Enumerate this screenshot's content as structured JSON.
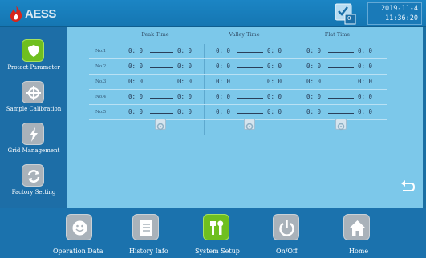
{
  "header": {
    "brand": "AESS",
    "status_count": "0",
    "date": "2019-11-4",
    "time": "11:36:20"
  },
  "sidebar": {
    "items": [
      {
        "label": "Protect Parameter",
        "icon": "shield-icon",
        "active": true
      },
      {
        "label": "Sample Calibration",
        "icon": "crosshair-icon",
        "active": false
      },
      {
        "label": "Grid Management",
        "icon": "lightning-icon",
        "active": false
      },
      {
        "label": "Factory Setting",
        "icon": "refresh-icon",
        "active": false
      }
    ]
  },
  "schedule": {
    "columns": [
      "Peak Time",
      "Valley Time",
      "Flat Time"
    ],
    "rows": [
      {
        "label": "No.1",
        "values": [
          [
            "0: 0",
            "0: 0"
          ],
          [
            "0: 0",
            "0: 0"
          ],
          [
            "0: 0",
            "0: 0"
          ]
        ]
      },
      {
        "label": "No.2",
        "values": [
          [
            "0: 0",
            "0: 0"
          ],
          [
            "0: 0",
            "0: 0"
          ],
          [
            "0: 0",
            "0: 0"
          ]
        ]
      },
      {
        "label": "No.3",
        "values": [
          [
            "0: 0",
            "0: 0"
          ],
          [
            "0: 0",
            "0: 0"
          ],
          [
            "0: 0",
            "0: 0"
          ]
        ]
      },
      {
        "label": "No.4",
        "values": [
          [
            "0: 0",
            "0: 0"
          ],
          [
            "0: 0",
            "0: 0"
          ],
          [
            "0: 0",
            "0: 0"
          ]
        ]
      },
      {
        "label": "No.5",
        "values": [
          [
            "0: 0",
            "0: 0"
          ],
          [
            "0: 0",
            "0: 0"
          ],
          [
            "0: 0",
            "0: 0"
          ]
        ]
      }
    ]
  },
  "nav": {
    "items": [
      {
        "label": "Operation Data",
        "icon": "smiley-icon",
        "active": false
      },
      {
        "label": "History Info",
        "icon": "document-icon",
        "active": false
      },
      {
        "label": "System Setup",
        "icon": "tools-icon",
        "active": true
      },
      {
        "label": "On/Off",
        "icon": "power-icon",
        "active": false
      },
      {
        "label": "Home",
        "icon": "home-icon",
        "active": false
      }
    ]
  },
  "colors": {
    "active_green": "#6fbf1f",
    "inactive_gray": "#a9b2ba",
    "panel_blue": "#7cc8ea",
    "brand_red": "#d8261b"
  }
}
